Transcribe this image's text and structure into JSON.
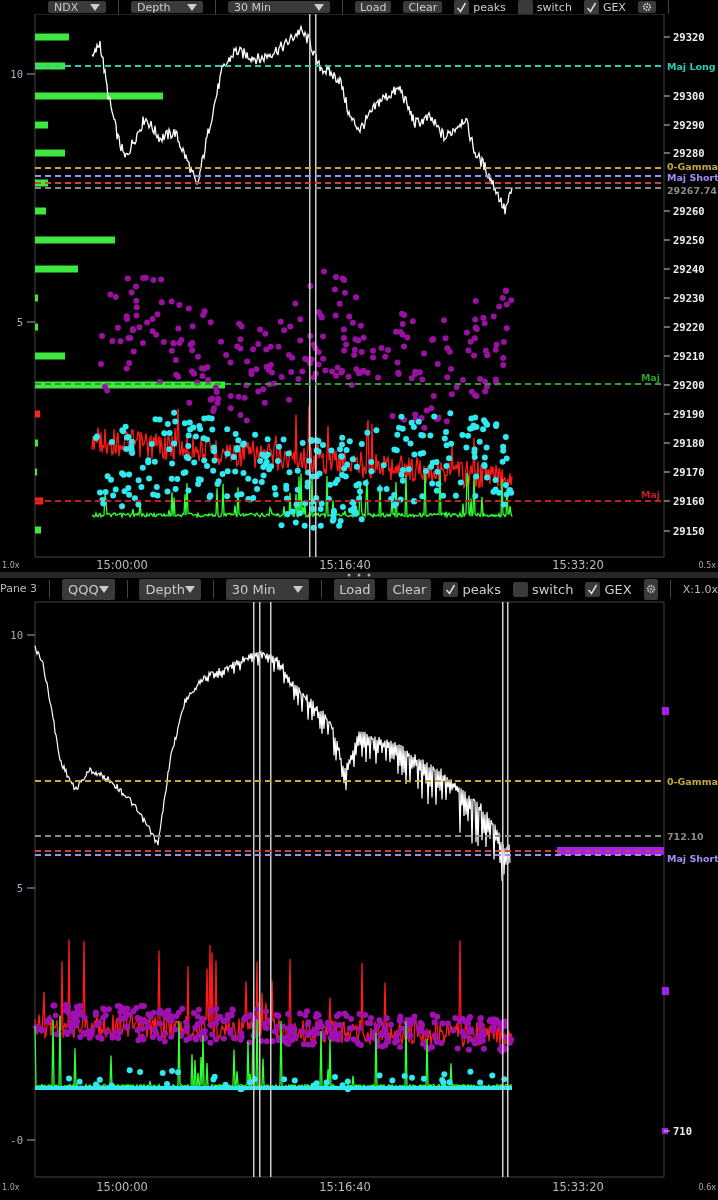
{
  "panes": [
    {
      "toolbar": {
        "dropdowns": [
          "NDX",
          "Depth",
          "30 Min"
        ],
        "buttons": [
          "Load",
          "Clear"
        ],
        "checkboxes": [
          {
            "label": "peaks",
            "checked": true
          },
          {
            "label": "switch",
            "checked": false
          },
          {
            "label": "GEX",
            "checked": true
          }
        ]
      },
      "left_axis": [
        "10",
        "5"
      ],
      "right_axis": [
        "29320",
        "29300",
        "29290",
        "29280",
        "29260",
        "29250",
        "29240",
        "29230",
        "29220",
        "29210",
        "29200",
        "29190",
        "29180",
        "29170",
        "29160",
        "29150"
      ],
      "levels": [
        {
          "label": "Maj Long",
          "color": "#2fc9b0"
        },
        {
          "label": "0-Gamma",
          "color": "#c8a838"
        },
        {
          "label": "Maj Short",
          "color": "#a08cf0"
        },
        {
          "color": "#d04040"
        },
        {
          "label": "29267.74",
          "color": "#8a8a8a"
        },
        {
          "label": "Maj",
          "color": "#2aa02a"
        },
        {
          "label": "Maj",
          "color": "#c02020"
        }
      ],
      "time_axis": [
        "15:00:00",
        "15:16:40",
        "15:33:20"
      ],
      "scale_left": "1.0x",
      "scale_right": "0.5x"
    },
    {
      "pane_label": "Pane 3",
      "toolbar": {
        "dropdowns": [
          "QQQ",
          "Depth",
          "30 Min"
        ],
        "buttons": [
          "Load",
          "Clear"
        ],
        "checkboxes": [
          {
            "label": "peaks",
            "checked": true
          },
          {
            "label": "switch",
            "checked": false
          },
          {
            "label": "GEX",
            "checked": true
          }
        ]
      },
      "zoom_readout": "X:1.0x",
      "left_axis": [
        "10",
        "5",
        "-0"
      ],
      "right_axis": [
        "710"
      ],
      "levels": [
        {
          "label": "0-Gamma",
          "color": "#c8a838"
        },
        {
          "label": "712.10",
          "color": "#8a8a8a"
        },
        {
          "color": "#d04040"
        },
        {
          "label": "Maj Short",
          "color": "#a08cf0"
        }
      ],
      "time_axis": [
        "15:00:00",
        "15:16:40",
        "15:33:20"
      ],
      "scale_left": "1.0x",
      "scale_right": "0.6x"
    }
  ]
}
